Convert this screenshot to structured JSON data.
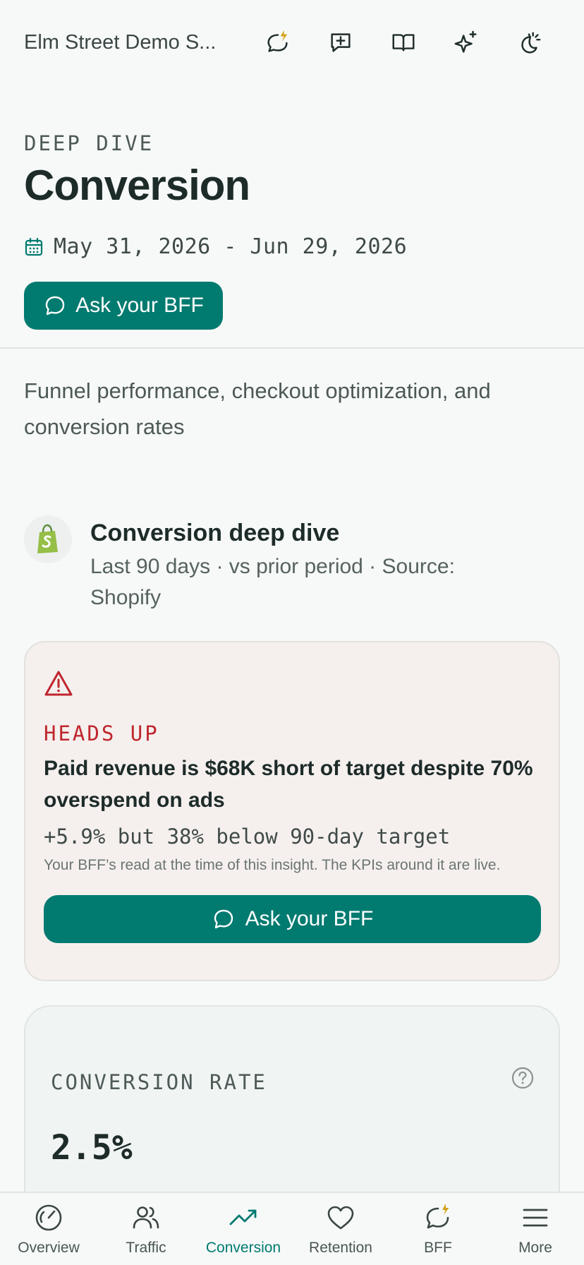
{
  "topbar": {
    "store_name": "Elm Street Demo S...",
    "icons": [
      "chat-bolt-icon",
      "add-comment-icon",
      "book-icon",
      "sparkles-icon",
      "theme-icon"
    ]
  },
  "header": {
    "eyebrow": "DEEP DIVE",
    "title": "Conversion",
    "date_range": "May 31, 2026 - Jun 29, 2026",
    "ask_label": "Ask your BFF"
  },
  "description": "Funnel performance, checkout optimization, and conversion rates",
  "section": {
    "title": "Conversion deep dive",
    "subtitle": "Last 90 days · vs prior period · Source: Shopify"
  },
  "alert": {
    "eyebrow": "HEADS UP",
    "title": "Paid revenue is $68K short of target despite 70% overspend on ads",
    "metric": "+5.9% but 38% below 90-day target",
    "note": "Your BFF’s read at the time of this insight. The KPIs around it are live.",
    "ask_label": "Ask your BFF"
  },
  "kpi": {
    "label": "CONVERSION RATE",
    "value": "2.5%"
  },
  "nav": {
    "items": [
      {
        "label": "Overview",
        "icon": "gauge-icon"
      },
      {
        "label": "Traffic",
        "icon": "users-icon"
      },
      {
        "label": "Conversion",
        "icon": "trending-up-icon",
        "active": true
      },
      {
        "label": "Retention",
        "icon": "heart-icon"
      },
      {
        "label": "BFF",
        "icon": "chat-bolt-icon"
      },
      {
        "label": "More",
        "icon": "menu-icon"
      }
    ]
  },
  "colors": {
    "accent": "#017a70",
    "alert": "#c0262d",
    "bolt": "#d4a017"
  }
}
